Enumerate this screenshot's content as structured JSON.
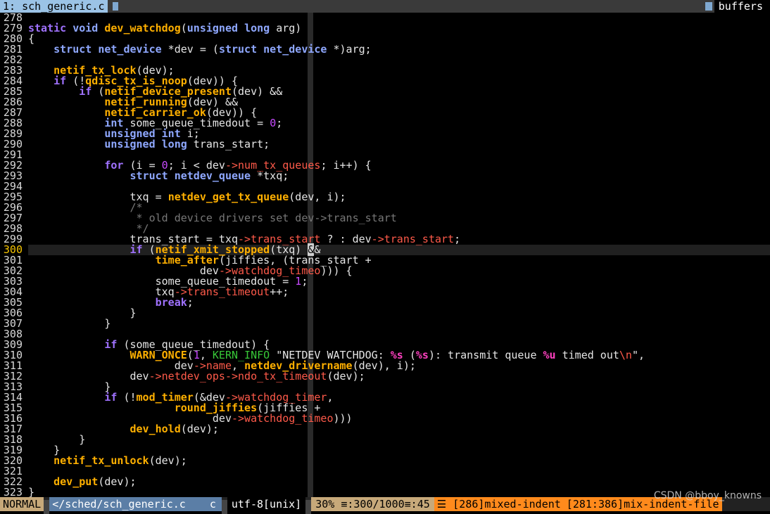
{
  "tabline": {
    "active_tab": "1: sch_generic.c",
    "right_label": "buffers"
  },
  "editor": {
    "cursor_line": 300,
    "lines": [
      {
        "n": "278",
        "html": ""
      },
      {
        "n": "279",
        "html": "<span class='kw'>static</span> <span class='ty'>void</span> <span class='fn'>dev_watchdog</span>(<span class='ty'>unsigned</span> <span class='ty'>long</span> arg)"
      },
      {
        "n": "280",
        "html": "{"
      },
      {
        "n": "281",
        "html": "    <span class='ty'>struct</span> <span class='ty'>net_device</span> *dev = (<span class='ty'>struct</span> <span class='ty'>net_device</span> *)arg;"
      },
      {
        "n": "282",
        "html": ""
      },
      {
        "n": "283",
        "html": "    <span class='fn'>netif_tx_lock</span>(dev);"
      },
      {
        "n": "284",
        "html": "    <span class='kw'>if</span> (!<span class='fn'>qdisc_tx_is_noop</span>(dev)) {"
      },
      {
        "n": "285",
        "html": "        <span class='kw'>if</span> (<span class='fn'>netif_device_present</span>(dev) &amp;&amp;"
      },
      {
        "n": "286",
        "html": "            <span class='fn'>netif_running</span>(dev) &amp;&amp;"
      },
      {
        "n": "287",
        "html": "            <span class='fn'>netif_carrier_ok</span>(dev)) {"
      },
      {
        "n": "288",
        "html": "            <span class='ty'>int</span> some_queue_timedout = <span class='num'>0</span>;"
      },
      {
        "n": "289",
        "html": "            <span class='ty'>unsigned</span> <span class='ty'>int</span> i;"
      },
      {
        "n": "290",
        "html": "            <span class='ty'>unsigned</span> <span class='ty'>long</span> trans_start;"
      },
      {
        "n": "291",
        "html": ""
      },
      {
        "n": "292",
        "html": "            <span class='kw'>for</span> (i = <span class='num'>0</span>; i &lt; dev<span class='mem'>-&gt;num_tx_queues</span>; i++) {"
      },
      {
        "n": "293",
        "html": "                <span class='ty'>struct</span> <span class='ty'>netdev_queue</span> *txq;"
      },
      {
        "n": "294",
        "html": ""
      },
      {
        "n": "295",
        "html": "                txq = <span class='fn'>netdev_get_tx_queue</span>(dev, i);"
      },
      {
        "n": "296",
        "html": "                <span class='cmt'>/*</span>"
      },
      {
        "n": "297",
        "html": "<span class='cmt'>                 * old device drivers set dev-&gt;trans_start</span>"
      },
      {
        "n": "298",
        "html": "<span class='cmt'>                 */</span>"
      },
      {
        "n": "299",
        "html": "                trans_start = txq<span class='mem'>-&gt;trans_start</span> ? : dev<span class='mem'>-&gt;trans_start</span>;"
      },
      {
        "n": "300",
        "html": "                <span class='kw'>if</span> (<span class='fn'>netif_xmit_stopped</span>(txq) <span class='cursor'>&amp;</span>&amp;"
      },
      {
        "n": "301",
        "html": "                    <span class='fn'>time_after</span>(jiffies, (trans_start +"
      },
      {
        "n": "302",
        "html": "                           dev<span class='mem'>-&gt;watchdog_timeo</span>))) {"
      },
      {
        "n": "303",
        "html": "                    some_queue_timedout = <span class='num'>1</span>;"
      },
      {
        "n": "304",
        "html": "                    txq<span class='mem'>-&gt;trans_timeout</span>++;"
      },
      {
        "n": "305",
        "html": "                    <span class='kw'>break</span>;"
      },
      {
        "n": "306",
        "html": "                }"
      },
      {
        "n": "307",
        "html": "            }"
      },
      {
        "n": "308",
        "html": ""
      },
      {
        "n": "309",
        "html": "            <span class='kw'>if</span> (some_queue_timedout) {"
      },
      {
        "n": "310",
        "html": "                <span class='fn'>WARN_ONCE</span>(<span class='num'>1</span>, <span class='kinfo'>KERN_INFO</span> \"NETDEV WATCHDOG: <span class='fmt'>%s</span> (<span class='fmt'>%s</span>): transmit queue <span class='fmt'>%u</span> timed out<span class='mem'>\\n</span>\","
      },
      {
        "n": "311",
        "html": "                       dev<span class='mem'>-&gt;name</span>, <span class='fn'>netdev_drivername</span>(dev), i);"
      },
      {
        "n": "312",
        "html": "                dev<span class='mem'>-&gt;netdev_ops-&gt;ndo_tx_timeout</span>(dev);"
      },
      {
        "n": "313",
        "html": "            }"
      },
      {
        "n": "314",
        "html": "            <span class='kw'>if</span> (!<span class='fn'>mod_timer</span>(&amp;dev<span class='mem'>-&gt;watchdog_timer</span>,"
      },
      {
        "n": "315",
        "html": "                       <span class='fn'>round_jiffies</span>(jiffies +"
      },
      {
        "n": "316",
        "html": "                             dev<span class='mem'>-&gt;watchdog_timeo</span>)))"
      },
      {
        "n": "317",
        "html": "                <span class='fn'>dev_hold</span>(dev);"
      },
      {
        "n": "318",
        "html": "        }"
      },
      {
        "n": "319",
        "html": "    }"
      },
      {
        "n": "320",
        "html": "    <span class='fn'>netif_tx_unlock</span>(dev);"
      },
      {
        "n": "321",
        "html": ""
      },
      {
        "n": "322",
        "html": "    <span class='fn'>dev_put</span>(dev);"
      },
      {
        "n": "323",
        "html": "}"
      }
    ]
  },
  "statusline": {
    "mode": "NORMAL",
    "file": "</sched/sch_generic.c",
    "filetype": "c",
    "encoding": "utf-8[unix]",
    "percent": "30%",
    "position": "≡:300/1000≡:45",
    "warning1": "☰ [286]mixed-indent",
    "warning2": "[281:386]mix-indent-file"
  },
  "watermark": "CSDN @bboy_knowns"
}
